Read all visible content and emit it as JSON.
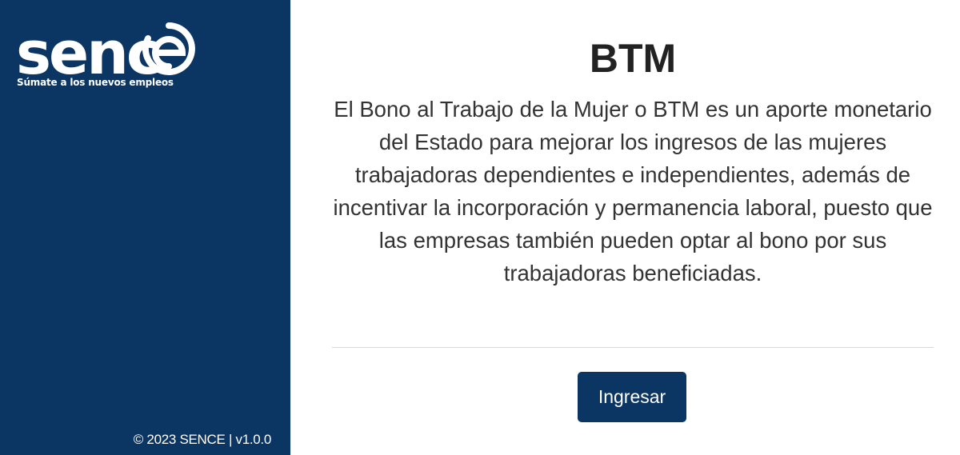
{
  "brand": {
    "logo_text": "senc",
    "logo_ring_letter": "e",
    "tagline": "Súmate a los nuevos empleos",
    "color_primary": "#0b3563"
  },
  "sidebar": {
    "footer": "© 2023 SENCE | v1.0.0"
  },
  "main": {
    "title": "BTM",
    "description": "El Bono al Trabajo de la Mujer o BTM es un aporte monetario del Estado para mejorar los ingresos de las mujeres trabajadoras dependientes e independientes, además de incentivar la incorporación y permanencia laboral, puesto que las empresas también pueden optar al bono por sus trabajadoras beneficiadas.",
    "login_label": "Ingresar"
  }
}
